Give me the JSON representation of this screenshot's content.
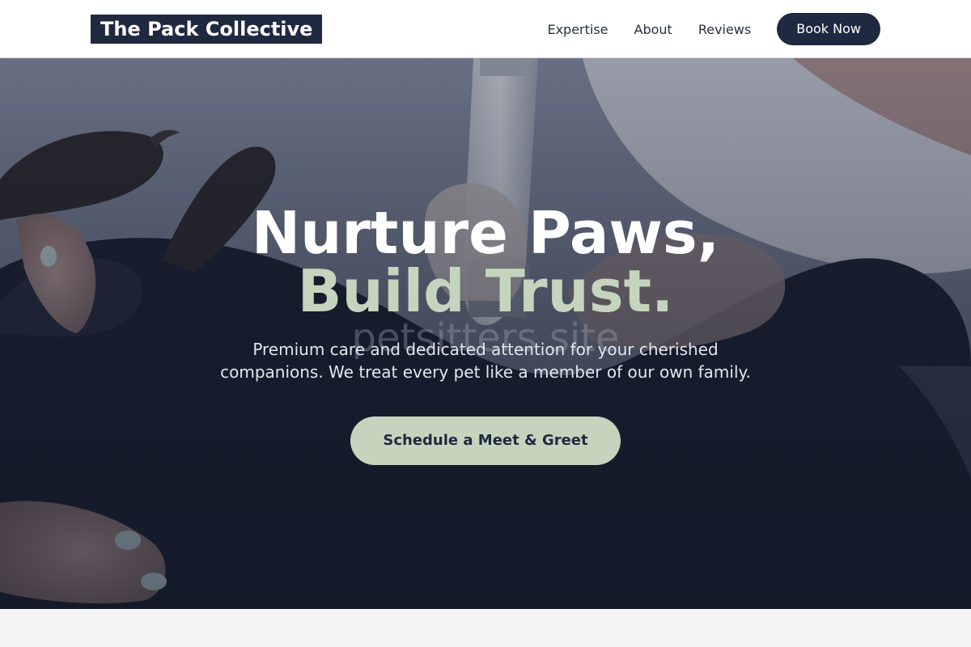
{
  "nav": {
    "logo": "The Pack Collective",
    "links": [
      "Expertise",
      "About",
      "Reviews"
    ],
    "cta": "Book Now"
  },
  "hero": {
    "title_line1": "Nurture Paws,",
    "title_line2": "Build Trust.",
    "watermark": "petsitters site",
    "subtitle": "Premium care and dedicated attention for your cherished companions. We treat every pet like a member of our own family.",
    "cta": "Schedule a Meet & Greet"
  },
  "colors": {
    "navy": "#1f2940",
    "sage": "#c5d5bd",
    "white": "#ffffff"
  }
}
